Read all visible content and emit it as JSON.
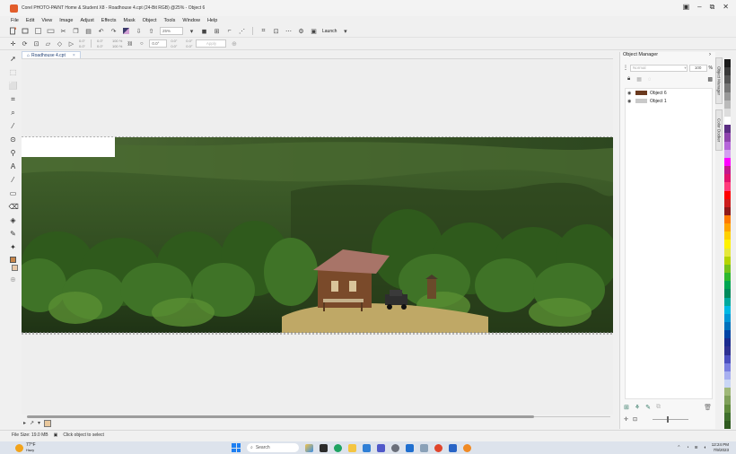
{
  "window": {
    "title": "Corel PHOTO-PAINT Home & Student X8 - Roadhouse 4.cpt (24-Bit RGB) @25% - Object 6",
    "controls": [
      "▣",
      "–",
      "⧉",
      "✕"
    ]
  },
  "menu": [
    {
      "label": "File"
    },
    {
      "label": "Edit"
    },
    {
      "label": "View"
    },
    {
      "label": "Image"
    },
    {
      "label": "Adjust"
    },
    {
      "label": "Effects"
    },
    {
      "label": "Mask"
    },
    {
      "label": "Object"
    },
    {
      "label": "Tools"
    },
    {
      "label": "Window"
    },
    {
      "label": "Help"
    }
  ],
  "toolbar": {
    "zoom_value": "25%",
    "launch_label": "Launch"
  },
  "property_bar": {
    "pos_x": "0.0\"",
    "pos_y": "0.0\"",
    "size_w": "0.0\"",
    "size_h": "0.0\"",
    "scale_w": "100 %",
    "scale_h": "100 %",
    "angle": "0.0°",
    "center_x": "0.0\"",
    "center_y": "0.0\"",
    "skew_x": "0.0°",
    "skew_y": "0.0°",
    "apply_label": "Apply"
  },
  "document_tab": {
    "label": "Roadhouse 4.cpt"
  },
  "status": {
    "file_size": "File Size: 19.0 MB",
    "hint": "Click object to select"
  },
  "object_manager": {
    "title": "Object Manager",
    "blend_mode": "Normal",
    "opacity": "100",
    "opacity_unit": "%",
    "objects": [
      {
        "name": "Object 6",
        "thumb_color": "#6b3a1f"
      },
      {
        "name": "Object 1",
        "thumb_color": "#c9c9c9"
      }
    ]
  },
  "docker_tabs": {
    "tab1": "Object Manager",
    "tab2": "Color Docker"
  },
  "palette": [
    "#1a1a1a",
    "#3a3a3a",
    "#555555",
    "#777777",
    "#999999",
    "#bbbbbb",
    "#dddddd",
    "#ffffff",
    "#5a2d82",
    "#8e44ad",
    "#b565d9",
    "#d39ff0",
    "#ff00ff",
    "#c2188c",
    "#e2136c",
    "#ff3b7b",
    "#ff0000",
    "#cc1d1d",
    "#8f1a1a",
    "#ff7a00",
    "#ffa400",
    "#ffd000",
    "#fff200",
    "#e5e83b",
    "#b5d400",
    "#74c21b",
    "#2eb82e",
    "#00a651",
    "#008a5a",
    "#00a99d",
    "#00b9e4",
    "#0096d6",
    "#0071bc",
    "#0044a5",
    "#1b2b8f",
    "#2e3192",
    "#4b4fbf",
    "#7a7fe0",
    "#a8b0f0",
    "#c9d6f5",
    "#9fb878",
    "#7fa05a",
    "#5f8a3c",
    "#3f6f2c",
    "#2f5a20"
  ],
  "taskbar": {
    "weather_temp": "77°F",
    "weather_desc": "Hazy",
    "search_placeholder": "Search",
    "time": "12:24 PM",
    "date": "7/9/2023"
  }
}
